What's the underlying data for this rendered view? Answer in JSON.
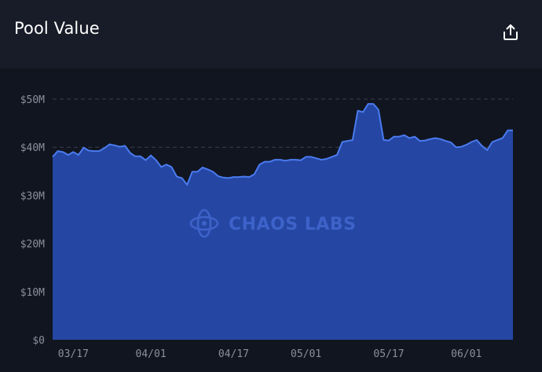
{
  "header": {
    "title": "Pool Value",
    "share_icon": "share-upload-icon"
  },
  "watermark": {
    "text": "CHAOS LABS",
    "icon": "chaos-labs-logo-icon"
  },
  "colors": {
    "background": "#111520",
    "header_background": "#181c28",
    "area_fill": "#2547a3",
    "line": "#4a7bf0",
    "grid": "#3a3f4d",
    "tick_text": "#8a8f9c"
  },
  "chart_data": {
    "type": "area",
    "title": "Pool Value",
    "xlabel": "",
    "ylabel": "",
    "yticks": [
      {
        "value": 0,
        "label": "$0"
      },
      {
        "value": 10,
        "label": "$10M"
      },
      {
        "value": 20,
        "label": "$20M"
      },
      {
        "value": 30,
        "label": "$30M"
      },
      {
        "value": 40,
        "label": "$40M"
      },
      {
        "value": 50,
        "label": "$50M"
      }
    ],
    "xticks": [
      {
        "date": "2023-03-17",
        "label": "03/17"
      },
      {
        "date": "2023-04-01",
        "label": "04/01"
      },
      {
        "date": "2023-04-17",
        "label": "04/17"
      },
      {
        "date": "2023-05-01",
        "label": "05/01"
      },
      {
        "date": "2023-05-17",
        "label": "05/17"
      },
      {
        "date": "2023-06-01",
        "label": "06/01"
      }
    ],
    "ylim": [
      0,
      50
    ],
    "xlim": [
      "2023-03-13",
      "2023-06-07"
    ],
    "grid": true,
    "y_unit": "M USD",
    "series": [
      {
        "name": "",
        "points": [
          [
            "2023-03-13",
            38.0
          ],
          [
            "2023-03-14",
            39.2
          ],
          [
            "2023-03-15",
            39.0
          ],
          [
            "2023-03-16",
            38.4
          ],
          [
            "2023-03-17",
            39.0
          ],
          [
            "2023-03-18",
            38.4
          ],
          [
            "2023-03-19",
            39.9
          ],
          [
            "2023-03-20",
            39.3
          ],
          [
            "2023-03-21",
            39.2
          ],
          [
            "2023-03-22",
            39.2
          ],
          [
            "2023-03-23",
            39.8
          ],
          [
            "2023-03-24",
            40.6
          ],
          [
            "2023-03-25",
            40.4
          ],
          [
            "2023-03-26",
            40.1
          ],
          [
            "2023-03-27",
            40.3
          ],
          [
            "2023-03-28",
            38.8
          ],
          [
            "2023-03-29",
            38.1
          ],
          [
            "2023-03-30",
            38.1
          ],
          [
            "2023-03-31",
            37.3
          ],
          [
            "2023-04-01",
            38.3
          ],
          [
            "2023-04-02",
            37.3
          ],
          [
            "2023-04-03",
            35.9
          ],
          [
            "2023-04-04",
            36.4
          ],
          [
            "2023-04-05",
            35.9
          ],
          [
            "2023-04-06",
            33.9
          ],
          [
            "2023-04-07",
            33.6
          ],
          [
            "2023-04-08",
            32.2
          ],
          [
            "2023-04-09",
            34.9
          ],
          [
            "2023-04-10",
            34.9
          ],
          [
            "2023-04-11",
            35.8
          ],
          [
            "2023-04-12",
            35.4
          ],
          [
            "2023-04-13",
            34.9
          ],
          [
            "2023-04-14",
            34.0
          ],
          [
            "2023-04-15",
            33.7
          ],
          [
            "2023-04-16",
            33.6
          ],
          [
            "2023-04-17",
            33.8
          ],
          [
            "2023-04-18",
            33.8
          ],
          [
            "2023-04-19",
            33.9
          ],
          [
            "2023-04-20",
            33.8
          ],
          [
            "2023-04-21",
            34.4
          ],
          [
            "2023-04-22",
            36.4
          ],
          [
            "2023-04-23",
            37.0
          ],
          [
            "2023-04-24",
            37.0
          ],
          [
            "2023-04-25",
            37.4
          ],
          [
            "2023-04-26",
            37.4
          ],
          [
            "2023-04-27",
            37.2
          ],
          [
            "2023-04-28",
            37.4
          ],
          [
            "2023-04-29",
            37.4
          ],
          [
            "2023-04-30",
            37.3
          ],
          [
            "2023-05-01",
            38.0
          ],
          [
            "2023-05-02",
            38.0
          ],
          [
            "2023-05-03",
            37.7
          ],
          [
            "2023-05-04",
            37.4
          ],
          [
            "2023-05-05",
            37.6
          ],
          [
            "2023-05-06",
            38.0
          ],
          [
            "2023-05-07",
            38.4
          ],
          [
            "2023-05-08",
            41.1
          ],
          [
            "2023-05-09",
            41.3
          ],
          [
            "2023-05-10",
            41.5
          ],
          [
            "2023-05-11",
            47.6
          ],
          [
            "2023-05-12",
            47.3
          ],
          [
            "2023-05-13",
            49.0
          ],
          [
            "2023-05-14",
            49.0
          ],
          [
            "2023-05-15",
            47.8
          ],
          [
            "2023-05-16",
            41.5
          ],
          [
            "2023-05-17",
            41.4
          ],
          [
            "2023-05-18",
            42.2
          ],
          [
            "2023-05-19",
            42.2
          ],
          [
            "2023-05-20",
            42.5
          ],
          [
            "2023-05-21",
            41.9
          ],
          [
            "2023-05-22",
            42.2
          ],
          [
            "2023-05-23",
            41.3
          ],
          [
            "2023-05-24",
            41.4
          ],
          [
            "2023-05-25",
            41.7
          ],
          [
            "2023-05-26",
            41.9
          ],
          [
            "2023-05-27",
            41.7
          ],
          [
            "2023-05-28",
            41.3
          ],
          [
            "2023-05-29",
            41.0
          ],
          [
            "2023-05-30",
            40.0
          ],
          [
            "2023-05-31",
            40.1
          ],
          [
            "2023-06-01",
            40.5
          ],
          [
            "2023-06-02",
            41.1
          ],
          [
            "2023-06-03",
            41.5
          ],
          [
            "2023-06-04",
            40.3
          ],
          [
            "2023-06-05",
            39.4
          ],
          [
            "2023-06-06",
            41.1
          ],
          [
            "2023-06-07",
            41.5
          ],
          [
            "2023-06-08",
            41.9
          ],
          [
            "2023-06-09",
            43.5
          ],
          [
            "2023-06-10",
            43.5
          ]
        ]
      }
    ]
  }
}
